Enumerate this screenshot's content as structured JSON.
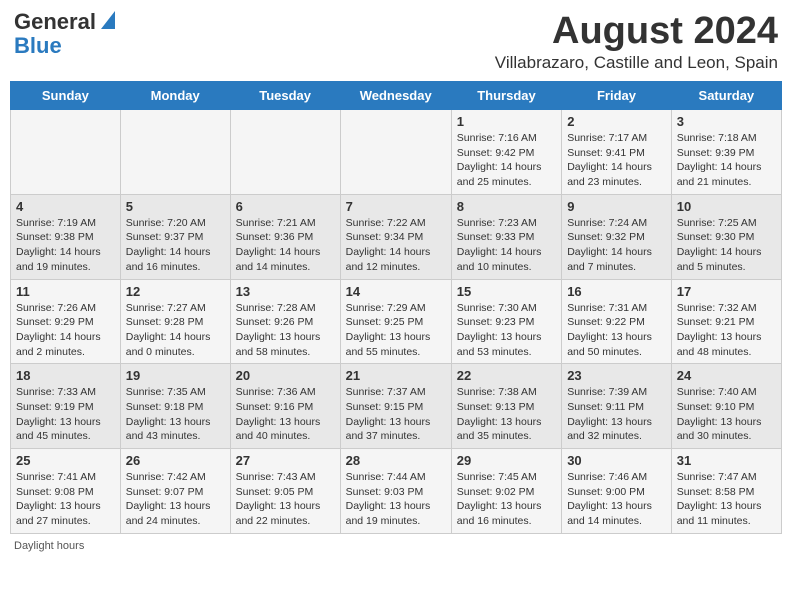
{
  "logo": {
    "general": "General",
    "blue": "Blue"
  },
  "title": "August 2024",
  "subtitle": "Villabrazaro, Castille and Leon, Spain",
  "days_of_week": [
    "Sunday",
    "Monday",
    "Tuesday",
    "Wednesday",
    "Thursday",
    "Friday",
    "Saturday"
  ],
  "weeks": [
    [
      {
        "day": "",
        "info": ""
      },
      {
        "day": "",
        "info": ""
      },
      {
        "day": "",
        "info": ""
      },
      {
        "day": "",
        "info": ""
      },
      {
        "day": "1",
        "info": "Sunrise: 7:16 AM\nSunset: 9:42 PM\nDaylight: 14 hours\nand 25 minutes."
      },
      {
        "day": "2",
        "info": "Sunrise: 7:17 AM\nSunset: 9:41 PM\nDaylight: 14 hours\nand 23 minutes."
      },
      {
        "day": "3",
        "info": "Sunrise: 7:18 AM\nSunset: 9:39 PM\nDaylight: 14 hours\nand 21 minutes."
      }
    ],
    [
      {
        "day": "4",
        "info": "Sunrise: 7:19 AM\nSunset: 9:38 PM\nDaylight: 14 hours\nand 19 minutes."
      },
      {
        "day": "5",
        "info": "Sunrise: 7:20 AM\nSunset: 9:37 PM\nDaylight: 14 hours\nand 16 minutes."
      },
      {
        "day": "6",
        "info": "Sunrise: 7:21 AM\nSunset: 9:36 PM\nDaylight: 14 hours\nand 14 minutes."
      },
      {
        "day": "7",
        "info": "Sunrise: 7:22 AM\nSunset: 9:34 PM\nDaylight: 14 hours\nand 12 minutes."
      },
      {
        "day": "8",
        "info": "Sunrise: 7:23 AM\nSunset: 9:33 PM\nDaylight: 14 hours\nand 10 minutes."
      },
      {
        "day": "9",
        "info": "Sunrise: 7:24 AM\nSunset: 9:32 PM\nDaylight: 14 hours\nand 7 minutes."
      },
      {
        "day": "10",
        "info": "Sunrise: 7:25 AM\nSunset: 9:30 PM\nDaylight: 14 hours\nand 5 minutes."
      }
    ],
    [
      {
        "day": "11",
        "info": "Sunrise: 7:26 AM\nSunset: 9:29 PM\nDaylight: 14 hours\nand 2 minutes."
      },
      {
        "day": "12",
        "info": "Sunrise: 7:27 AM\nSunset: 9:28 PM\nDaylight: 14 hours\nand 0 minutes."
      },
      {
        "day": "13",
        "info": "Sunrise: 7:28 AM\nSunset: 9:26 PM\nDaylight: 13 hours\nand 58 minutes."
      },
      {
        "day": "14",
        "info": "Sunrise: 7:29 AM\nSunset: 9:25 PM\nDaylight: 13 hours\nand 55 minutes."
      },
      {
        "day": "15",
        "info": "Sunrise: 7:30 AM\nSunset: 9:23 PM\nDaylight: 13 hours\nand 53 minutes."
      },
      {
        "day": "16",
        "info": "Sunrise: 7:31 AM\nSunset: 9:22 PM\nDaylight: 13 hours\nand 50 minutes."
      },
      {
        "day": "17",
        "info": "Sunrise: 7:32 AM\nSunset: 9:21 PM\nDaylight: 13 hours\nand 48 minutes."
      }
    ],
    [
      {
        "day": "18",
        "info": "Sunrise: 7:33 AM\nSunset: 9:19 PM\nDaylight: 13 hours\nand 45 minutes."
      },
      {
        "day": "19",
        "info": "Sunrise: 7:35 AM\nSunset: 9:18 PM\nDaylight: 13 hours\nand 43 minutes."
      },
      {
        "day": "20",
        "info": "Sunrise: 7:36 AM\nSunset: 9:16 PM\nDaylight: 13 hours\nand 40 minutes."
      },
      {
        "day": "21",
        "info": "Sunrise: 7:37 AM\nSunset: 9:15 PM\nDaylight: 13 hours\nand 37 minutes."
      },
      {
        "day": "22",
        "info": "Sunrise: 7:38 AM\nSunset: 9:13 PM\nDaylight: 13 hours\nand 35 minutes."
      },
      {
        "day": "23",
        "info": "Sunrise: 7:39 AM\nSunset: 9:11 PM\nDaylight: 13 hours\nand 32 minutes."
      },
      {
        "day": "24",
        "info": "Sunrise: 7:40 AM\nSunset: 9:10 PM\nDaylight: 13 hours\nand 30 minutes."
      }
    ],
    [
      {
        "day": "25",
        "info": "Sunrise: 7:41 AM\nSunset: 9:08 PM\nDaylight: 13 hours\nand 27 minutes."
      },
      {
        "day": "26",
        "info": "Sunrise: 7:42 AM\nSunset: 9:07 PM\nDaylight: 13 hours\nand 24 minutes."
      },
      {
        "day": "27",
        "info": "Sunrise: 7:43 AM\nSunset: 9:05 PM\nDaylight: 13 hours\nand 22 minutes."
      },
      {
        "day": "28",
        "info": "Sunrise: 7:44 AM\nSunset: 9:03 PM\nDaylight: 13 hours\nand 19 minutes."
      },
      {
        "day": "29",
        "info": "Sunrise: 7:45 AM\nSunset: 9:02 PM\nDaylight: 13 hours\nand 16 minutes."
      },
      {
        "day": "30",
        "info": "Sunrise: 7:46 AM\nSunset: 9:00 PM\nDaylight: 13 hours\nand 14 minutes."
      },
      {
        "day": "31",
        "info": "Sunrise: 7:47 AM\nSunset: 8:58 PM\nDaylight: 13 hours\nand 11 minutes."
      }
    ]
  ],
  "footer": "Daylight hours"
}
